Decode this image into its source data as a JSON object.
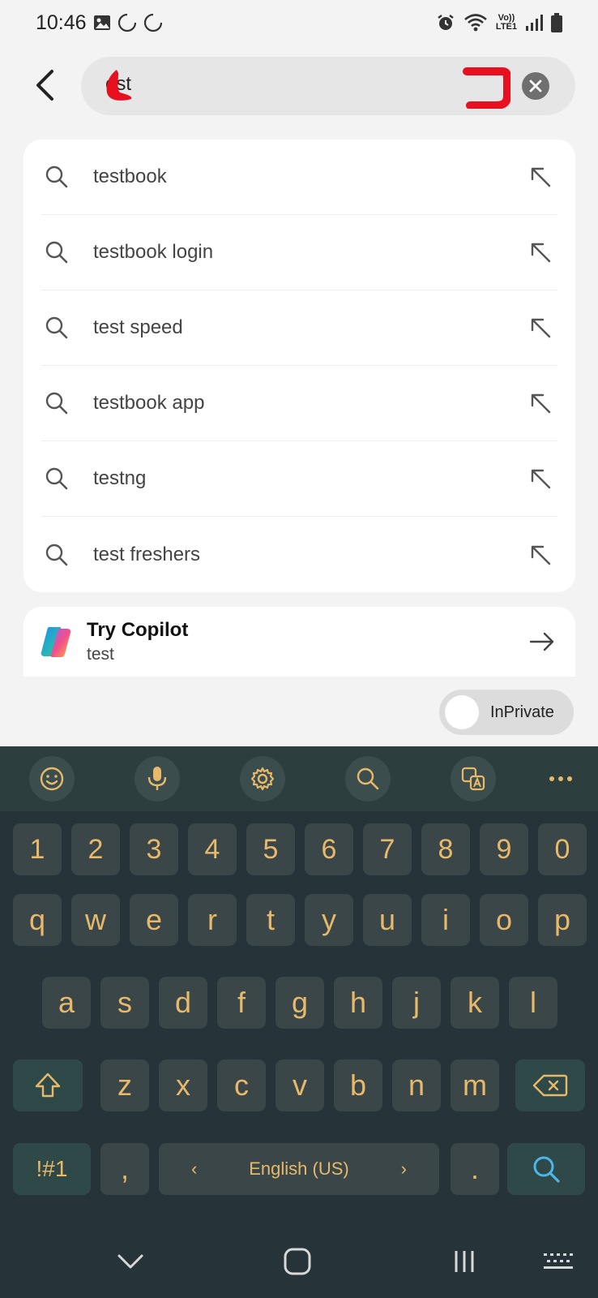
{
  "status_bar": {
    "time": "10:46",
    "network_label": "Vo))\nLTE1",
    "icons": [
      "gallery-icon",
      "sync-circle-icon",
      "sync-circle-icon",
      "alarm-icon",
      "wifi-icon",
      "lte-icon",
      "signal-icon",
      "battery-icon"
    ]
  },
  "search": {
    "query": "test",
    "visible_query": "est"
  },
  "suggestions": [
    {
      "label": "testbook"
    },
    {
      "label": "testbook login"
    },
    {
      "label": "test speed"
    },
    {
      "label": "testbook app"
    },
    {
      "label": "testng"
    },
    {
      "label": "test freshers"
    }
  ],
  "copilot": {
    "title": "Try Copilot",
    "subtitle": "test"
  },
  "inprivate": {
    "label": "InPrivate",
    "enabled": false
  },
  "keyboard": {
    "number_row": [
      "1",
      "2",
      "3",
      "4",
      "5",
      "6",
      "7",
      "8",
      "9",
      "0"
    ],
    "row1": [
      "q",
      "w",
      "e",
      "r",
      "t",
      "y",
      "u",
      "i",
      "o",
      "p"
    ],
    "row2": [
      "a",
      "s",
      "d",
      "f",
      "g",
      "h",
      "j",
      "k",
      "l"
    ],
    "row3": [
      "z",
      "x",
      "c",
      "v",
      "b",
      "n",
      "m"
    ],
    "symbols_key": "!#1",
    "comma_key": ",",
    "period_key": ".",
    "language": "English (US)",
    "lang_left": "‹",
    "lang_right": "›",
    "key_color": "#e8b96a",
    "accent_color": "#4db6e8"
  },
  "colors": {
    "background": "#f3f3f3",
    "keyboard_bg": "#263338",
    "annotation_red": "#e8101e"
  }
}
